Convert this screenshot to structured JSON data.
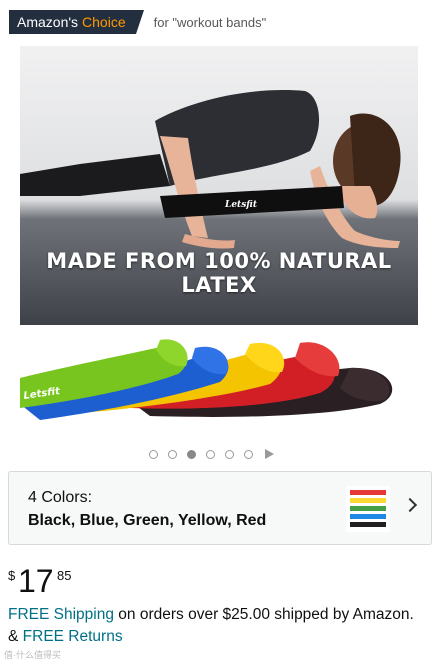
{
  "badge": {
    "prefix": "Amazon's",
    "choice": "Choice",
    "for_text": "for \"workout bands\""
  },
  "hero": {
    "brand_on_band": "Letsfit",
    "caption": "MADE FROM 100% NATURAL LATEX"
  },
  "bands_text": "Letsfit",
  "carousel": {
    "total": 6,
    "active_index": 2
  },
  "colors": {
    "count_label": "4 Colors:",
    "list": "Black, Blue, Green, Yellow, Red",
    "swatches": [
      "#e53935",
      "#fdd835",
      "#43a047",
      "#1e88e5",
      "#212121"
    ]
  },
  "price": {
    "symbol": "$",
    "whole": "17",
    "fraction": "85"
  },
  "shipping": {
    "free_shipping": "FREE Shipping",
    "middle": " on orders over $25.00 shipped by Amazon. & ",
    "free_returns": "FREE Returns"
  },
  "watermark": "值·什么值得买"
}
